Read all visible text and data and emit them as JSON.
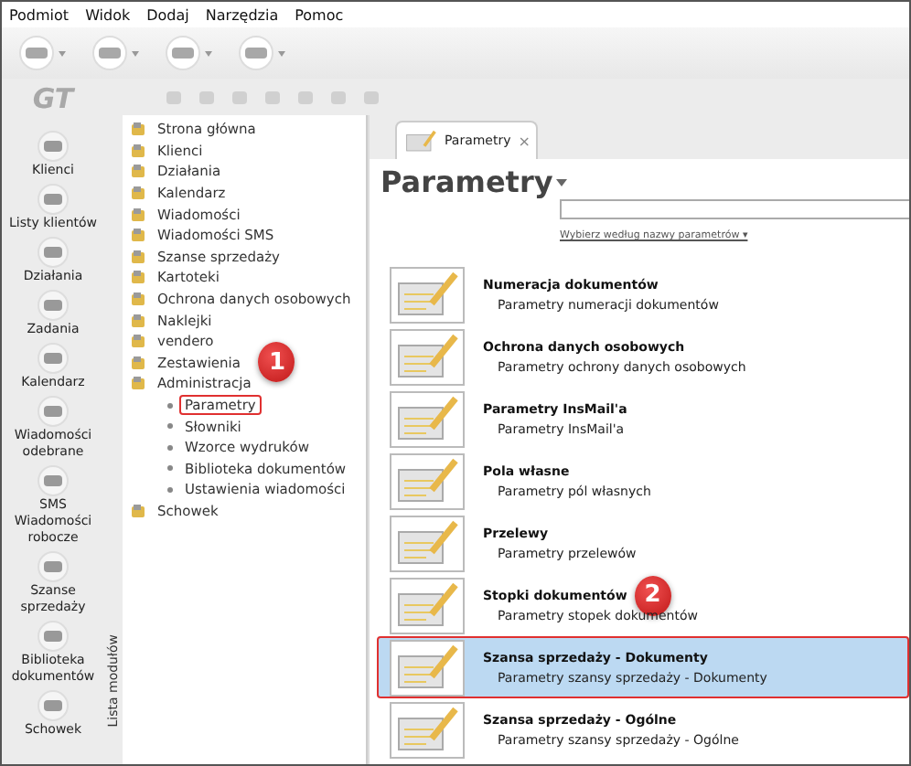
{
  "menu": [
    "Podmiot",
    "Widok",
    "Dodaj",
    "Narzędzia",
    "Pomoc"
  ],
  "logo": "GT",
  "sidebar": [
    {
      "label": "Klienci"
    },
    {
      "label": "Listy klientów"
    },
    {
      "label": "Działania"
    },
    {
      "label": "Zadania"
    },
    {
      "label": "Kalendarz"
    },
    {
      "label": "Wiadomości odebrane"
    },
    {
      "label": "SMS Wiadomości robocze"
    },
    {
      "label": "Szanse sprzedaży"
    },
    {
      "label": "Biblioteka dokumentów"
    },
    {
      "label": "Schowek"
    }
  ],
  "module_strip": "Lista modułów",
  "tree": [
    {
      "label": "Strona główna",
      "selected": false
    },
    {
      "label": "Klienci",
      "selected": false
    },
    {
      "label": "Działania",
      "selected": false
    },
    {
      "label": "Kalendarz",
      "selected": false
    },
    {
      "label": "Wiadomości",
      "selected": false
    },
    {
      "label": "Wiadomości SMS",
      "selected": false
    },
    {
      "label": "Szanse sprzedaży",
      "selected": false
    },
    {
      "label": "Kartoteki",
      "selected": false
    },
    {
      "label": "Ochrona danych osobowych",
      "selected": false
    },
    {
      "label": "Naklejki",
      "selected": false
    },
    {
      "label": "vendero",
      "selected": false
    },
    {
      "label": "Zestawienia",
      "selected": false,
      "callout": "1"
    },
    {
      "label": "Administracja",
      "selected": false,
      "children": [
        {
          "label": "Parametry",
          "selected": true
        },
        {
          "label": "Słowniki",
          "selected": false
        },
        {
          "label": "Wzorce wydruków",
          "selected": false
        },
        {
          "label": "Biblioteka dokumentów",
          "selected": false
        },
        {
          "label": "Ustawienia wiadomości",
          "selected": false
        }
      ]
    },
    {
      "label": "Schowek",
      "selected": false
    }
  ],
  "tab": {
    "label": "Parametry",
    "close": "×"
  },
  "heading": "Parametry",
  "filter_link": "Wybierz według nazwy parametrów ▾",
  "params": [
    {
      "title": "Numeracja dokumentów",
      "subtitle": "Parametry numeracji dokumentów",
      "selected": false
    },
    {
      "title": "Ochrona danych osobowych",
      "subtitle": "Parametry ochrony danych osobowych",
      "selected": false
    },
    {
      "title": "Parametry InsMail'a",
      "subtitle": "Parametry InsMail'a",
      "selected": false
    },
    {
      "title": "Pola własne",
      "subtitle": "Parametry pól własnych",
      "selected": false
    },
    {
      "title": "Przelewy",
      "subtitle": "Parametry przelewów",
      "selected": false
    },
    {
      "title": "Stopki dokumentów",
      "subtitle": "Parametry stopek dokumentów",
      "selected": false,
      "callout": "2"
    },
    {
      "title": "Szansa sprzedaży - Dokumenty",
      "subtitle": "Parametry szansy sprzedaży - Dokumenty",
      "selected": true
    },
    {
      "title": "Szansa sprzedaży - Ogólne",
      "subtitle": "Parametry szansy sprzedaży - Ogólne",
      "selected": false
    }
  ]
}
